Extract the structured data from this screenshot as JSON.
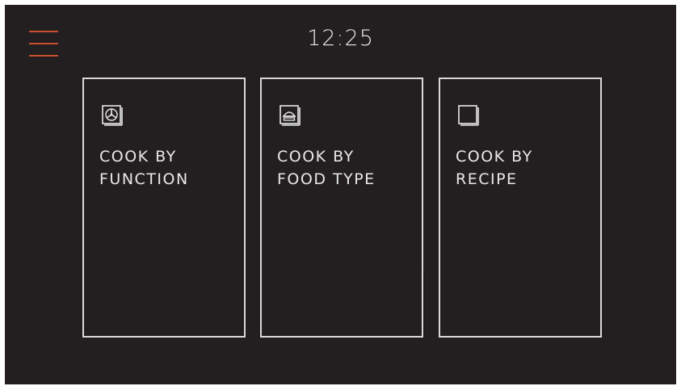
{
  "header": {
    "time": "12:25",
    "menu_icon": "hamburger-menu-icon"
  },
  "colors": {
    "background": "#231f20",
    "accent": "#c8502e",
    "foreground": "#e8e8e8"
  },
  "cards": [
    {
      "line1": "COOK BY",
      "line2": "FUNCTION",
      "icon": "fan-function-icon"
    },
    {
      "line1": "COOK BY",
      "line2": "FOOD TYPE",
      "icon": "food-dish-icon"
    },
    {
      "line1": "COOK BY",
      "line2": "RECIPE",
      "icon": "recipe-book-icon"
    }
  ]
}
